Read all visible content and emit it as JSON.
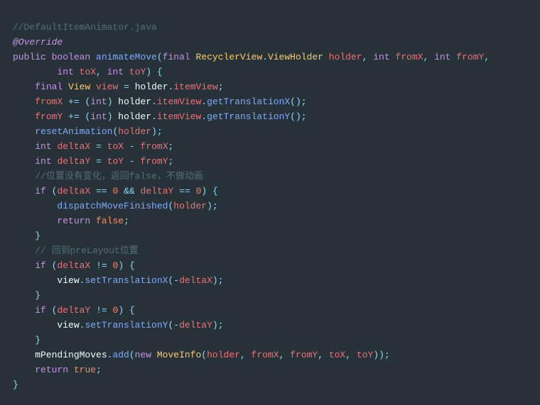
{
  "code": {
    "tokens": [
      [
        {
          "t": "//DefaultItemAnimator.java",
          "c": "cmt"
        }
      ],
      [
        {
          "t": "@Override",
          "c": "ann"
        }
      ],
      [
        {
          "t": "public",
          "c": "kw"
        },
        {
          "t": " ",
          "c": "txt"
        },
        {
          "t": "boolean",
          "c": "kw"
        },
        {
          "t": " ",
          "c": "txt"
        },
        {
          "t": "animateMove",
          "c": "fn"
        },
        {
          "t": "(",
          "c": "pun"
        },
        {
          "t": "final",
          "c": "kw"
        },
        {
          "t": " ",
          "c": "txt"
        },
        {
          "t": "RecyclerView",
          "c": "typ"
        },
        {
          "t": ".",
          "c": "pun"
        },
        {
          "t": "ViewHolder",
          "c": "typ"
        },
        {
          "t": " ",
          "c": "txt"
        },
        {
          "t": "holder",
          "c": "var"
        },
        {
          "t": ",",
          "c": "pun"
        },
        {
          "t": " ",
          "c": "txt"
        },
        {
          "t": "int",
          "c": "kw"
        },
        {
          "t": " ",
          "c": "txt"
        },
        {
          "t": "fromX",
          "c": "var"
        },
        {
          "t": ",",
          "c": "pun"
        },
        {
          "t": " ",
          "c": "txt"
        },
        {
          "t": "int",
          "c": "kw"
        },
        {
          "t": " ",
          "c": "txt"
        },
        {
          "t": "fromY",
          "c": "var"
        },
        {
          "t": ",",
          "c": "pun"
        }
      ],
      [
        {
          "t": "        ",
          "c": "txt"
        },
        {
          "t": "int",
          "c": "kw"
        },
        {
          "t": " ",
          "c": "txt"
        },
        {
          "t": "toX",
          "c": "var"
        },
        {
          "t": ",",
          "c": "pun"
        },
        {
          "t": " ",
          "c": "txt"
        },
        {
          "t": "int",
          "c": "kw"
        },
        {
          "t": " ",
          "c": "txt"
        },
        {
          "t": "toY",
          "c": "var"
        },
        {
          "t": ")",
          "c": "pun"
        },
        {
          "t": " ",
          "c": "txt"
        },
        {
          "t": "{",
          "c": "pun"
        }
      ],
      [
        {
          "t": "    ",
          "c": "txt"
        },
        {
          "t": "final",
          "c": "kw"
        },
        {
          "t": " ",
          "c": "txt"
        },
        {
          "t": "View",
          "c": "typ"
        },
        {
          "t": " ",
          "c": "txt"
        },
        {
          "t": "view",
          "c": "var"
        },
        {
          "t": " ",
          "c": "txt"
        },
        {
          "t": "=",
          "c": "op"
        },
        {
          "t": " holder",
          "c": "txt"
        },
        {
          "t": ".",
          "c": "pun"
        },
        {
          "t": "itemView",
          "c": "var"
        },
        {
          "t": ";",
          "c": "pun"
        }
      ],
      [
        {
          "t": "    ",
          "c": "txt"
        },
        {
          "t": "fromX",
          "c": "var"
        },
        {
          "t": " ",
          "c": "txt"
        },
        {
          "t": "+=",
          "c": "op"
        },
        {
          "t": " ",
          "c": "txt"
        },
        {
          "t": "(",
          "c": "pun"
        },
        {
          "t": "int",
          "c": "kw"
        },
        {
          "t": ")",
          "c": "pun"
        },
        {
          "t": " holder",
          "c": "txt"
        },
        {
          "t": ".",
          "c": "pun"
        },
        {
          "t": "itemView",
          "c": "var"
        },
        {
          "t": ".",
          "c": "pun"
        },
        {
          "t": "getTranslationX",
          "c": "fn"
        },
        {
          "t": "()",
          "c": "pun"
        },
        {
          "t": ";",
          "c": "pun"
        }
      ],
      [
        {
          "t": "    ",
          "c": "txt"
        },
        {
          "t": "fromY",
          "c": "var"
        },
        {
          "t": " ",
          "c": "txt"
        },
        {
          "t": "+=",
          "c": "op"
        },
        {
          "t": " ",
          "c": "txt"
        },
        {
          "t": "(",
          "c": "pun"
        },
        {
          "t": "int",
          "c": "kw"
        },
        {
          "t": ")",
          "c": "pun"
        },
        {
          "t": " holder",
          "c": "txt"
        },
        {
          "t": ".",
          "c": "pun"
        },
        {
          "t": "itemView",
          "c": "var"
        },
        {
          "t": ".",
          "c": "pun"
        },
        {
          "t": "getTranslationY",
          "c": "fn"
        },
        {
          "t": "()",
          "c": "pun"
        },
        {
          "t": ";",
          "c": "pun"
        }
      ],
      [
        {
          "t": "    ",
          "c": "txt"
        },
        {
          "t": "resetAnimation",
          "c": "fn"
        },
        {
          "t": "(",
          "c": "pun"
        },
        {
          "t": "holder",
          "c": "var"
        },
        {
          "t": ")",
          "c": "pun"
        },
        {
          "t": ";",
          "c": "pun"
        }
      ],
      [
        {
          "t": "    ",
          "c": "txt"
        },
        {
          "t": "int",
          "c": "kw"
        },
        {
          "t": " ",
          "c": "txt"
        },
        {
          "t": "deltaX",
          "c": "var"
        },
        {
          "t": " ",
          "c": "txt"
        },
        {
          "t": "=",
          "c": "op"
        },
        {
          "t": " ",
          "c": "txt"
        },
        {
          "t": "toX",
          "c": "var"
        },
        {
          "t": " ",
          "c": "txt"
        },
        {
          "t": "-",
          "c": "op"
        },
        {
          "t": " ",
          "c": "txt"
        },
        {
          "t": "fromX",
          "c": "var"
        },
        {
          "t": ";",
          "c": "pun"
        }
      ],
      [
        {
          "t": "    ",
          "c": "txt"
        },
        {
          "t": "int",
          "c": "kw"
        },
        {
          "t": " ",
          "c": "txt"
        },
        {
          "t": "deltaY",
          "c": "var"
        },
        {
          "t": " ",
          "c": "txt"
        },
        {
          "t": "=",
          "c": "op"
        },
        {
          "t": " ",
          "c": "txt"
        },
        {
          "t": "toY",
          "c": "var"
        },
        {
          "t": " ",
          "c": "txt"
        },
        {
          "t": "-",
          "c": "op"
        },
        {
          "t": " ",
          "c": "txt"
        },
        {
          "t": "fromY",
          "c": "var"
        },
        {
          "t": ";",
          "c": "pun"
        }
      ],
      [
        {
          "t": "    ",
          "c": "txt"
        },
        {
          "t": "//位置没有变化，返回false，不做动画",
          "c": "cmt"
        }
      ],
      [
        {
          "t": "    ",
          "c": "txt"
        },
        {
          "t": "if",
          "c": "kw"
        },
        {
          "t": " ",
          "c": "txt"
        },
        {
          "t": "(",
          "c": "pun"
        },
        {
          "t": "deltaX",
          "c": "var"
        },
        {
          "t": " ",
          "c": "txt"
        },
        {
          "t": "==",
          "c": "op"
        },
        {
          "t": " ",
          "c": "txt"
        },
        {
          "t": "0",
          "c": "num"
        },
        {
          "t": " ",
          "c": "txt"
        },
        {
          "t": "&&",
          "c": "op"
        },
        {
          "t": " ",
          "c": "txt"
        },
        {
          "t": "deltaY",
          "c": "var"
        },
        {
          "t": " ",
          "c": "txt"
        },
        {
          "t": "==",
          "c": "op"
        },
        {
          "t": " ",
          "c": "txt"
        },
        {
          "t": "0",
          "c": "num"
        },
        {
          "t": ")",
          "c": "pun"
        },
        {
          "t": " ",
          "c": "txt"
        },
        {
          "t": "{",
          "c": "pun"
        }
      ],
      [
        {
          "t": "        ",
          "c": "txt"
        },
        {
          "t": "dispatchMoveFinished",
          "c": "fn"
        },
        {
          "t": "(",
          "c": "pun"
        },
        {
          "t": "holder",
          "c": "var"
        },
        {
          "t": ")",
          "c": "pun"
        },
        {
          "t": ";",
          "c": "pun"
        }
      ],
      [
        {
          "t": "        ",
          "c": "txt"
        },
        {
          "t": "return",
          "c": "kw"
        },
        {
          "t": " ",
          "c": "txt"
        },
        {
          "t": "false",
          "c": "num"
        },
        {
          "t": ";",
          "c": "pun"
        }
      ],
      [
        {
          "t": "    ",
          "c": "txt"
        },
        {
          "t": "}",
          "c": "pun"
        }
      ],
      [
        {
          "t": "    ",
          "c": "txt"
        },
        {
          "t": "// 回到preLayout位置",
          "c": "cmt"
        }
      ],
      [
        {
          "t": "    ",
          "c": "txt"
        },
        {
          "t": "if",
          "c": "kw"
        },
        {
          "t": " ",
          "c": "txt"
        },
        {
          "t": "(",
          "c": "pun"
        },
        {
          "t": "deltaX",
          "c": "var"
        },
        {
          "t": " ",
          "c": "txt"
        },
        {
          "t": "!=",
          "c": "op"
        },
        {
          "t": " ",
          "c": "txt"
        },
        {
          "t": "0",
          "c": "num"
        },
        {
          "t": ")",
          "c": "pun"
        },
        {
          "t": " ",
          "c": "txt"
        },
        {
          "t": "{",
          "c": "pun"
        }
      ],
      [
        {
          "t": "        view",
          "c": "txt"
        },
        {
          "t": ".",
          "c": "pun"
        },
        {
          "t": "setTranslationX",
          "c": "fn"
        },
        {
          "t": "(",
          "c": "pun"
        },
        {
          "t": "-",
          "c": "op"
        },
        {
          "t": "deltaX",
          "c": "var"
        },
        {
          "t": ")",
          "c": "pun"
        },
        {
          "t": ";",
          "c": "pun"
        }
      ],
      [
        {
          "t": "    ",
          "c": "txt"
        },
        {
          "t": "}",
          "c": "pun"
        }
      ],
      [
        {
          "t": "    ",
          "c": "txt"
        },
        {
          "t": "if",
          "c": "kw"
        },
        {
          "t": " ",
          "c": "txt"
        },
        {
          "t": "(",
          "c": "pun"
        },
        {
          "t": "deltaY",
          "c": "var"
        },
        {
          "t": " ",
          "c": "txt"
        },
        {
          "t": "!=",
          "c": "op"
        },
        {
          "t": " ",
          "c": "txt"
        },
        {
          "t": "0",
          "c": "num"
        },
        {
          "t": ")",
          "c": "pun"
        },
        {
          "t": " ",
          "c": "txt"
        },
        {
          "t": "{",
          "c": "pun"
        }
      ],
      [
        {
          "t": "        view",
          "c": "txt"
        },
        {
          "t": ".",
          "c": "pun"
        },
        {
          "t": "setTranslationY",
          "c": "fn"
        },
        {
          "t": "(",
          "c": "pun"
        },
        {
          "t": "-",
          "c": "op"
        },
        {
          "t": "deltaY",
          "c": "var"
        },
        {
          "t": ")",
          "c": "pun"
        },
        {
          "t": ";",
          "c": "pun"
        }
      ],
      [
        {
          "t": "    ",
          "c": "txt"
        },
        {
          "t": "}",
          "c": "pun"
        }
      ],
      [
        {
          "t": "    mPendingMoves",
          "c": "txt"
        },
        {
          "t": ".",
          "c": "pun"
        },
        {
          "t": "add",
          "c": "fn"
        },
        {
          "t": "(",
          "c": "pun"
        },
        {
          "t": "new",
          "c": "kw"
        },
        {
          "t": " ",
          "c": "txt"
        },
        {
          "t": "MoveInfo",
          "c": "typ"
        },
        {
          "t": "(",
          "c": "pun"
        },
        {
          "t": "holder",
          "c": "var"
        },
        {
          "t": ",",
          "c": "pun"
        },
        {
          "t": " ",
          "c": "txt"
        },
        {
          "t": "fromX",
          "c": "var"
        },
        {
          "t": ",",
          "c": "pun"
        },
        {
          "t": " ",
          "c": "txt"
        },
        {
          "t": "fromY",
          "c": "var"
        },
        {
          "t": ",",
          "c": "pun"
        },
        {
          "t": " ",
          "c": "txt"
        },
        {
          "t": "toX",
          "c": "var"
        },
        {
          "t": ",",
          "c": "pun"
        },
        {
          "t": " ",
          "c": "txt"
        },
        {
          "t": "toY",
          "c": "var"
        },
        {
          "t": "))",
          "c": "pun"
        },
        {
          "t": ";",
          "c": "pun"
        }
      ],
      [
        {
          "t": "    ",
          "c": "txt"
        },
        {
          "t": "return",
          "c": "kw"
        },
        {
          "t": " ",
          "c": "txt"
        },
        {
          "t": "true",
          "c": "num"
        },
        {
          "t": ";",
          "c": "pun"
        }
      ],
      [
        {
          "t": "}",
          "c": "pun"
        }
      ]
    ]
  }
}
